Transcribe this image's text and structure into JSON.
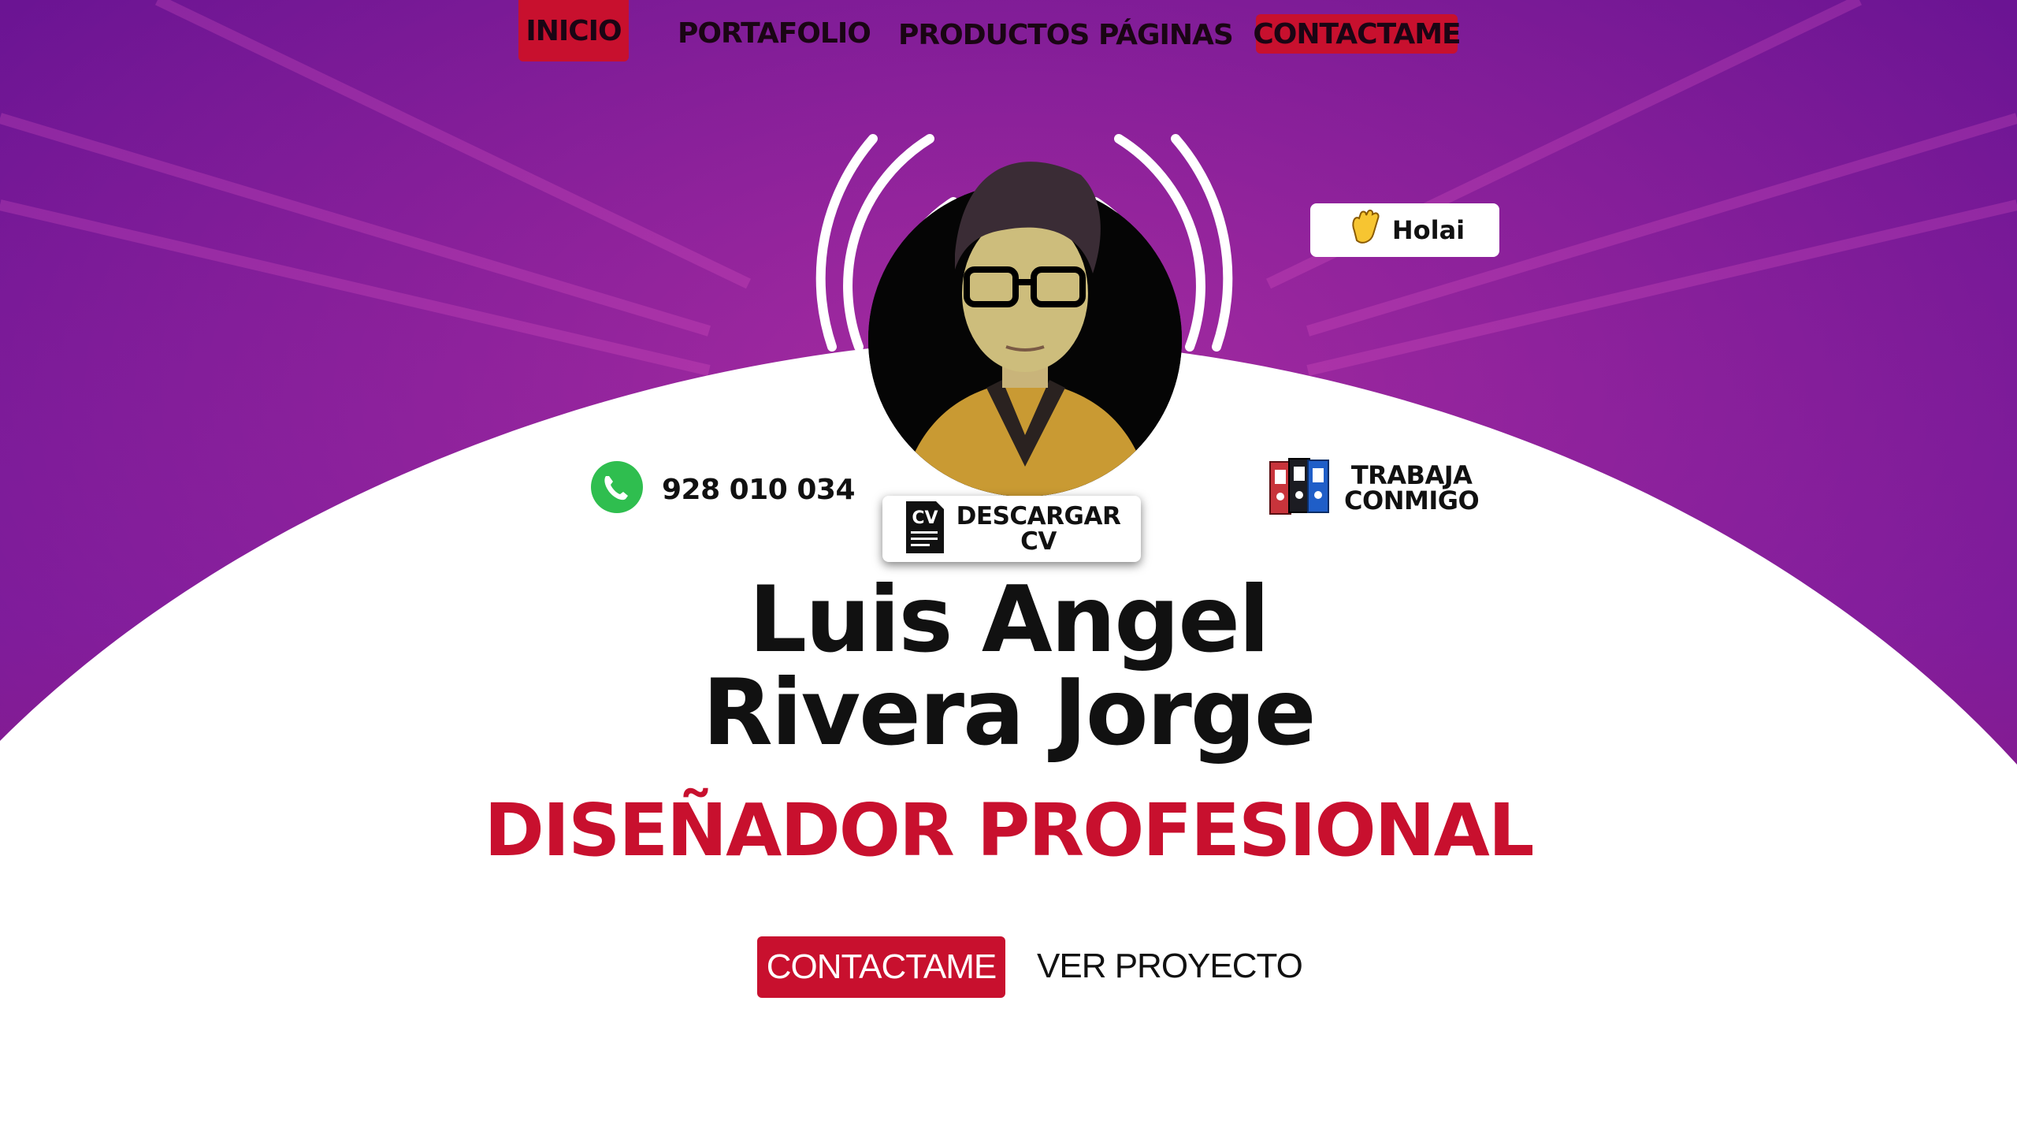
{
  "nav": {
    "items": [
      {
        "label": "INICIO",
        "active": true
      },
      {
        "label": "PORTAFOLIO"
      },
      {
        "label": "PRODUCTOS"
      },
      {
        "label": "PÁGINAS"
      },
      {
        "label": "CONTACTAME",
        "highlight": true
      }
    ]
  },
  "greeting": {
    "label": "Holai",
    "icon": "waving-hand-icon"
  },
  "contact_phone": {
    "number": "928 010 034",
    "icon": "whatsapp-icon"
  },
  "work_with_me": {
    "line1": "TRABAJA",
    "line2": "CONMIGO",
    "icon": "binders-icon"
  },
  "cv_button": {
    "line1": "DESCARGAR",
    "line2": "CV",
    "icon_text": "CV"
  },
  "hero": {
    "name_line1": "Luis Angel",
    "name_line2": "Rivera Jorge",
    "role": "DISEÑADOR PROFESIONAL"
  },
  "actions": {
    "contact_label": "CONTACTAME",
    "project_label": "VER PROYECTO"
  },
  "colors": {
    "accent": "#c8102e",
    "hero_purple": "#6a1a9a",
    "hero_magenta": "#9a1f7a"
  }
}
